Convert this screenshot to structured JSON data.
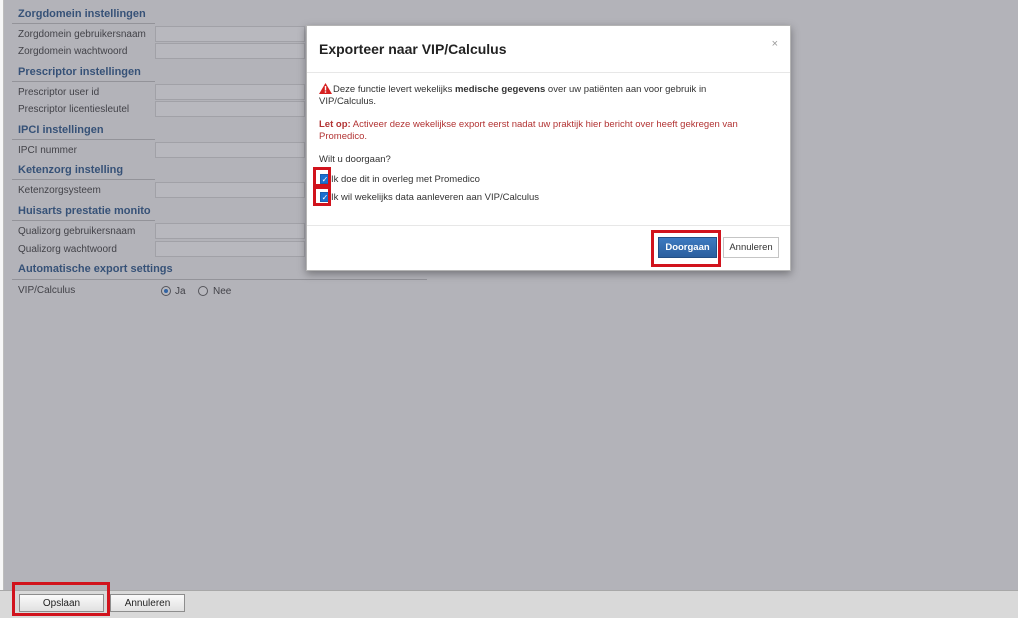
{
  "settings": {
    "sections": [
      {
        "title": "Zorgdomein instellingen",
        "rows": [
          "Zorgdomein gebruikersnaam",
          "Zorgdomein wachtwoord"
        ]
      },
      {
        "title": "Prescriptor instellingen",
        "rows": [
          "Prescriptor user id",
          "Prescriptor licentiesleutel"
        ]
      },
      {
        "title": "IPCI instellingen",
        "rows": [
          "IPCI nummer"
        ]
      },
      {
        "title": "Ketenzorg instelling",
        "rows": [
          "Ketenzorgsysteem"
        ]
      },
      {
        "title": "Huisarts prestatie monito",
        "rows": [
          "Qualizorg gebruikersnaam",
          "Qualizorg wachtwoord"
        ]
      },
      {
        "title": "Automatische export settings",
        "rows": [
          "VIP/Calculus"
        ]
      }
    ],
    "vip_options": {
      "ja": "Ja",
      "nee": "Nee",
      "selected": "Ja"
    }
  },
  "footer": {
    "save_label": "Opslaan",
    "cancel_label": "Annuleren"
  },
  "modal": {
    "title": "Exporteer naar VIP/Calculus",
    "close_symbol": "×",
    "warning_icon": "warning-triangle",
    "warning_pre": "Deze functie levert wekelijks ",
    "warning_bold": "medische gegevens",
    "warning_post": " over uw patiënten aan voor gebruik in VIP/Calculus.",
    "note_bold": "Let op:",
    "note_text": " Activeer deze wekelijkse export eerst nadat uw praktijk hier bericht over heeft gekregen van Promedico.",
    "question": "Wilt u doorgaan?",
    "checkbox1": "Ik doe dit in overleg met Promedico",
    "checkbox2": "Ik wil wekelijks data aanleveren aan VIP/Calculus",
    "continue_label": "Doorgaan",
    "cancel_label": "Annuleren"
  },
  "colors": {
    "accent": "#2b5f9f",
    "highlight": "#d1131d",
    "header_text": "#1f4f86",
    "note": "#b23333"
  }
}
